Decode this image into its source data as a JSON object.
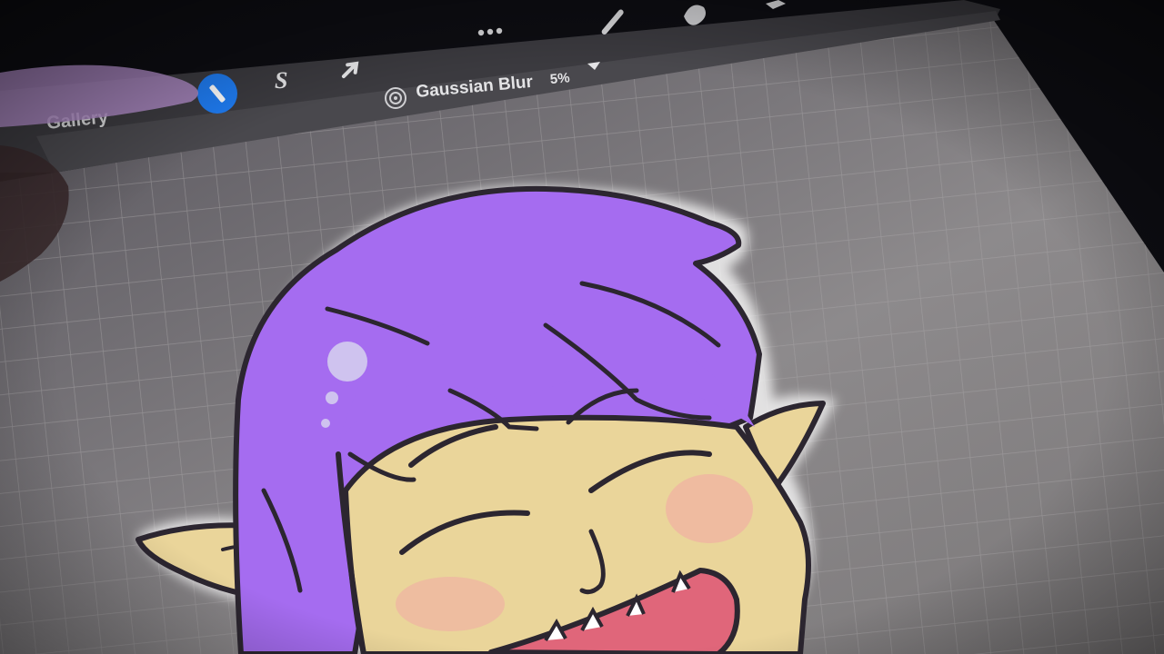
{
  "app": {
    "gallery_label": "Gallery",
    "more_icon": "ellipsis-icon",
    "toolbar": {
      "adjustment_name": "Gaussian Blur",
      "adjustment_value": "5%",
      "adjustment_icon": "blur-target-icon",
      "tools": [
        "brush-icon",
        "smudge-icon",
        "eraser-icon"
      ],
      "left_tools": [
        "wrench-icon",
        "selection-s-icon",
        "transform-arrow-icon"
      ]
    }
  },
  "canvas": {
    "grid": true,
    "subject": "cartoon elf character with purple hair laughing"
  },
  "colors": {
    "hair": "#a56cf0",
    "skin": "#ead59a",
    "outline": "#2c2630",
    "canvas_bg": "#7a7778",
    "toolbar_bg": "#4a4a4e",
    "accent_blue": "#1f7cf2",
    "mouth": "#e0667a"
  }
}
